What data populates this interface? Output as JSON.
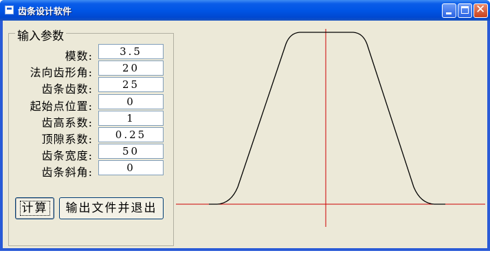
{
  "window": {
    "title": "齿条设计软件"
  },
  "params": {
    "group_label": "输入参数",
    "rows": [
      {
        "label": "模数:",
        "value": "3.5"
      },
      {
        "label": "法向齿形角:",
        "value": "20"
      },
      {
        "label": "齿条齿数:",
        "value": "25"
      },
      {
        "label": "起始点位置:",
        "value": "0"
      },
      {
        "label": "齿高系数:",
        "value": "1"
      },
      {
        "label": "顶隙系数:",
        "value": "0.25"
      },
      {
        "label": "齿条宽度:",
        "value": "50"
      },
      {
        "label": "齿条斜角:",
        "value": "0"
      }
    ]
  },
  "buttons": {
    "calc_label": "计算",
    "export_label": "输出文件并退出"
  },
  "plot": {
    "axis_color": "#cc0000",
    "profile_color": "#000000"
  }
}
